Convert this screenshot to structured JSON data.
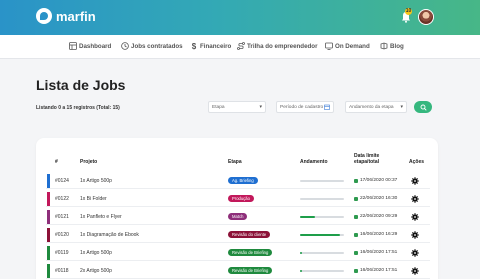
{
  "brand": {
    "name": "marfin"
  },
  "header": {
    "notifications_count": "10"
  },
  "nav": [
    {
      "label": "Dashboard",
      "icon": "dashboard-icon"
    },
    {
      "label": "Jobs contratados",
      "icon": "briefcase-icon"
    },
    {
      "label": "Financeiro",
      "icon": "dollar-icon"
    },
    {
      "label": "Trilha do empreendedor",
      "icon": "route-icon"
    },
    {
      "label": "On Demand",
      "icon": "monitor-icon"
    },
    {
      "label": "Blog",
      "icon": "blog-icon"
    }
  ],
  "page": {
    "title": "Lista de Jobs",
    "listing": "Listando 0 a 15 registros (Total: 15)"
  },
  "filters": {
    "etapa": "Etapa",
    "periodo": "Período de cadastro",
    "andamento": "Andamento da etapa"
  },
  "table": {
    "headers": {
      "num": "#",
      "projeto": "Projeto",
      "etapa": "Etapa",
      "andamento": "Andamento",
      "data_line1": "Data limite",
      "data_line2": "etapa/total",
      "acoes": "Ações"
    },
    "rows": [
      {
        "num": "#0124",
        "projeto": "1x Artigo 500p",
        "etapa": "Ag. Briefing",
        "etapa_color": "#1f6fd1",
        "bar_color": "#1f6fd1",
        "progress": 0,
        "date": "17/06/2020 00:37"
      },
      {
        "num": "#0122",
        "projeto": "1x Bi Folder",
        "etapa": "Produção",
        "etapa_color": "#c2185b",
        "bar_color": "#c2185b",
        "progress": 0,
        "date": "22/06/2020 16:30"
      },
      {
        "num": "#0121",
        "projeto": "1x Panfleto e Flyer",
        "etapa": "Match",
        "etapa_color": "#8e2f7a",
        "bar_color": "#8e2f7a",
        "progress": 0.35,
        "date": "22/06/2020 09:29"
      },
      {
        "num": "#0120",
        "projeto": "1x Diagramação de Ebook",
        "etapa": "Revisão do cliente",
        "etapa_color": "#8c1238",
        "bar_color": "#8c1238",
        "progress": 0.92,
        "date": "16/06/2020 16:29"
      },
      {
        "num": "#0119",
        "projeto": "1x Artigo 500p",
        "etapa": "Revisão de Briefing",
        "etapa_color": "#1f8a3e",
        "bar_color": "#1f8a3e",
        "progress": 0.05,
        "date": "16/06/2020 17:51"
      },
      {
        "num": "#0118",
        "projeto": "2x Artigo 500p",
        "etapa": "Revisão de Briefing",
        "etapa_color": "#1f8a3e",
        "bar_color": "#1f8a3e",
        "progress": 0.05,
        "date": "16/06/2020 17:51"
      }
    ]
  }
}
